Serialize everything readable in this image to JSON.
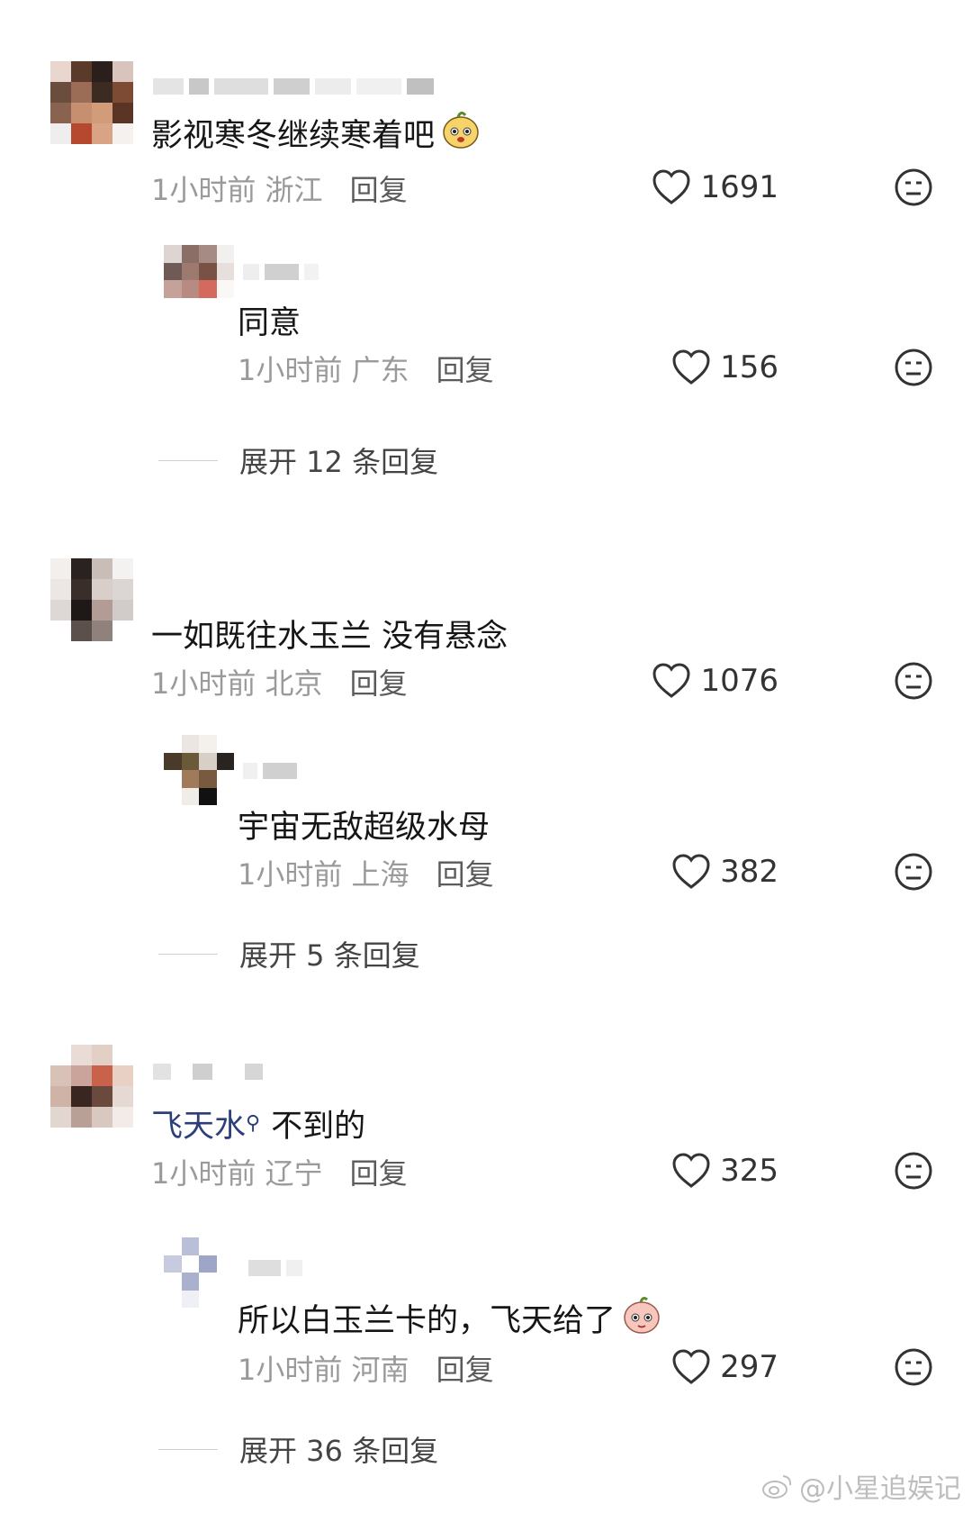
{
  "comments": [
    {
      "text": "影视寒冬继续寒着吧",
      "time": "1小时前",
      "location": "浙江",
      "reply": "回复",
      "likes": "1691",
      "replies": [
        {
          "text": "同意",
          "time": "1小时前",
          "location": "广东",
          "reply": "回复",
          "likes": "156"
        }
      ],
      "expand": "展开 12 条回复"
    },
    {
      "text": "一如既往水玉兰 没有悬念",
      "time": "1小时前",
      "location": "北京",
      "reply": "回复",
      "likes": "1076",
      "replies": [
        {
          "text": "宇宙无敌超级水母",
          "time": "1小时前",
          "location": "上海",
          "reply": "回复",
          "likes": "382"
        }
      ],
      "expand": "展开 5 条回复"
    },
    {
      "text_link": "飞天水",
      "text_rest": "不到的",
      "time": "1小时前",
      "location": "辽宁",
      "reply": "回复",
      "likes": "325",
      "replies": [
        {
          "text": "所以白玉兰卡的，飞天给了",
          "time": "1小时前",
          "location": "河南",
          "reply": "回复",
          "likes": "297"
        }
      ],
      "expand": "展开 36 条回复"
    }
  ],
  "watermark": "@小星追娱记",
  "icons": {
    "like": "heart-outline-icon",
    "dislike": "neutral-face-icon",
    "search": "search-icon",
    "weibo": "weibo-logo-icon"
  }
}
